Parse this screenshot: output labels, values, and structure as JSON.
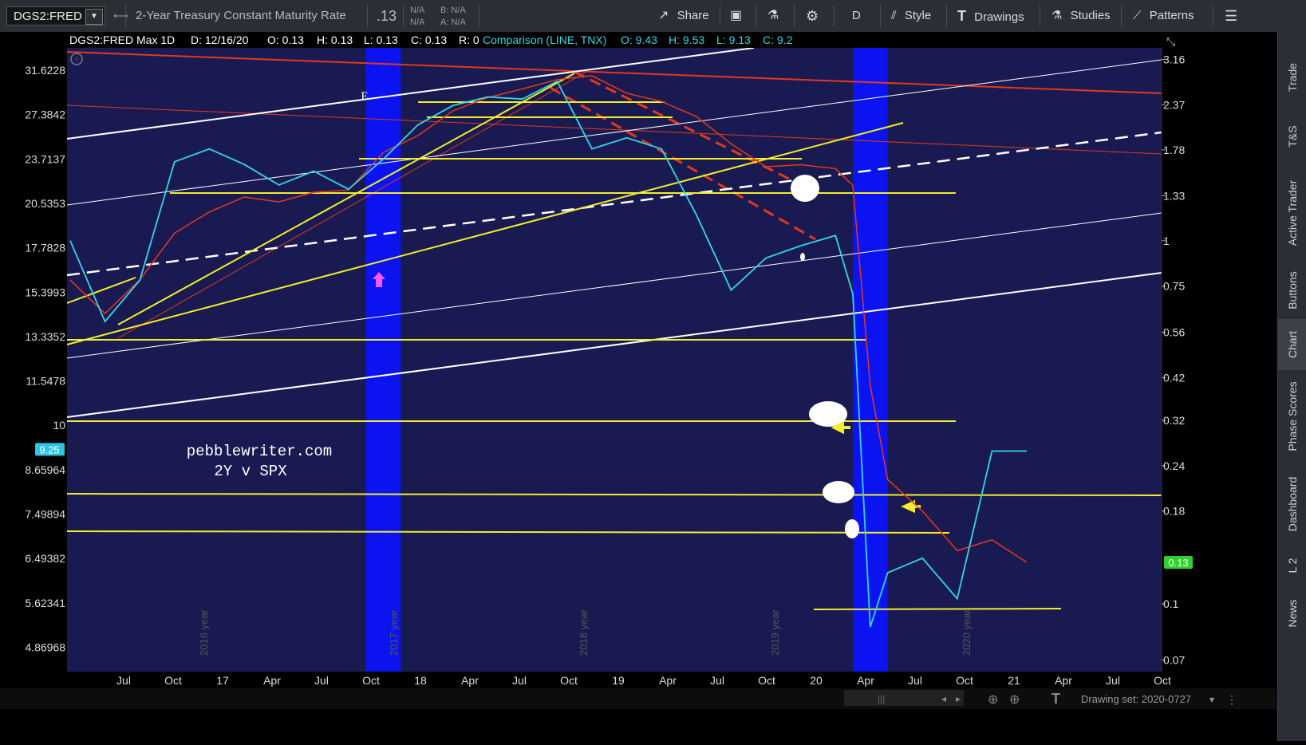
{
  "toolbar": {
    "symbol": "DGS2:FRED",
    "description": "2-Year Treasury Constant Maturity Rate",
    "last": ".13",
    "na1": "N/A",
    "na2": "N/A",
    "bid": "B: N/A",
    "ask": "A: N/A",
    "share": "Share",
    "period": "D",
    "style": "Style",
    "drawings": "Drawings",
    "studies": "Studies",
    "patterns": "Patterns"
  },
  "header": {
    "title": "DGS2:FRED Max 1D",
    "date": "D: 12/16/20",
    "open": "O: 0.13",
    "high": "H: 0.13",
    "low": "L: 0.13",
    "close": "C: 0.13",
    "range": "R: 0",
    "comparison": "Comparison (LINE, TNX)",
    "c_open": "O: 9.43",
    "c_high": "H: 9.53",
    "c_low": "L: 9.13",
    "c_close": "C: 9.2"
  },
  "sidebar": [
    "Trade",
    "T&S",
    "Active Trader",
    "Buttons",
    "Chart",
    "Phase Scores",
    "Dashboard",
    "L 2",
    "News"
  ],
  "status": {
    "drawing_set": "Drawing set: 2020-0727"
  },
  "colors": {
    "plot_bg": "#1a1a52",
    "highlight": "#0b14f0",
    "yellow": "#f2ee28",
    "red": "#e4381a",
    "white": "#ffffff",
    "cyan": "#2fd8e8",
    "price_tag": "#2fd12f"
  },
  "chart_data": {
    "type": "line",
    "annotation_text": [
      "pebblewriter.com",
      "2Y v SPX"
    ],
    "annotation_letter": "E",
    "left_axis_ticks": [
      "31.6228",
      "27.3842",
      "23.7137",
      "20.5353",
      "17.7828",
      "15.3993",
      "13.3352",
      "11.5478",
      "10",
      "8.65964",
      "7.49894",
      "6.49382",
      "5.62341",
      "4.86968"
    ],
    "left_axis_current": "9.25",
    "right_axis_ticks": [
      "3.16",
      "2.37",
      "1.78",
      "1.33",
      "1",
      "0.75",
      "0.56",
      "0.42",
      "0.32",
      "0.24",
      "0.18",
      "0.1",
      "0.07"
    ],
    "right_axis_current": "0.13",
    "x_tick_labels": [
      "Jul",
      "Oct",
      "17",
      "Apr",
      "Jul",
      "Oct",
      "18",
      "Apr",
      "Jul",
      "Oct",
      "19",
      "Apr",
      "Jul",
      "Oct",
      "20",
      "Apr",
      "Jul",
      "Oct",
      "21",
      "Apr",
      "Jul",
      "Oct"
    ],
    "year_markers": [
      "2016 year",
      "2017 year",
      "2018 year",
      "2019 year",
      "2020 year"
    ],
    "highlight_periods": [
      [
        "2017-10",
        "2017-12"
      ],
      [
        "2020-02",
        "2020-04"
      ]
    ],
    "series": [
      {
        "name": "DGS2:FRED",
        "color": "#e4381a",
        "x": [
          "2016-05",
          "2016-07",
          "2016-09",
          "2016-11",
          "2017-01",
          "2017-03",
          "2017-05",
          "2017-07",
          "2017-09",
          "2017-11",
          "2018-01",
          "2018-03",
          "2018-05",
          "2018-07",
          "2018-09",
          "2018-11",
          "2019-01",
          "2019-03",
          "2019-05",
          "2019-07",
          "2019-09",
          "2019-11",
          "2020-01",
          "2020-02",
          "2020-03",
          "2020-04",
          "2020-06",
          "2020-08",
          "2020-10",
          "2020-12"
        ],
        "y": [
          0.78,
          0.63,
          0.78,
          1.05,
          1.2,
          1.32,
          1.28,
          1.36,
          1.38,
          1.75,
          1.95,
          2.28,
          2.48,
          2.62,
          2.78,
          2.85,
          2.55,
          2.42,
          2.2,
          1.85,
          1.6,
          1.62,
          1.58,
          1.42,
          0.4,
          0.22,
          0.18,
          0.14,
          0.15,
          0.13
        ]
      },
      {
        "name": "TNX",
        "color": "#2fd8e8",
        "x": [
          "2016-05",
          "2016-07",
          "2016-09",
          "2016-11",
          "2017-01",
          "2017-03",
          "2017-05",
          "2017-07",
          "2017-09",
          "2017-11",
          "2018-01",
          "2018-03",
          "2018-05",
          "2018-07",
          "2018-09",
          "2018-11",
          "2019-01",
          "2019-03",
          "2019-05",
          "2019-07",
          "2019-09",
          "2019-11",
          "2020-01",
          "2020-02",
          "2020-03",
          "2020-04",
          "2020-06",
          "2020-08",
          "2020-10",
          "2020-12"
        ],
        "y": [
          18.2,
          14.0,
          16.0,
          23.5,
          24.5,
          23.3,
          21.8,
          22.8,
          21.5,
          23.7,
          26.5,
          28.2,
          29.0,
          28.8,
          30.5,
          24.5,
          25.4,
          24.5,
          19.8,
          15.5,
          17.2,
          17.9,
          18.5,
          15.3,
          5.2,
          6.2,
          6.5,
          5.7,
          9.2,
          9.2
        ]
      }
    ],
    "ylim_left": [
      4.5,
      34
    ],
    "ylim_right": [
      0.065,
      3.4
    ]
  }
}
